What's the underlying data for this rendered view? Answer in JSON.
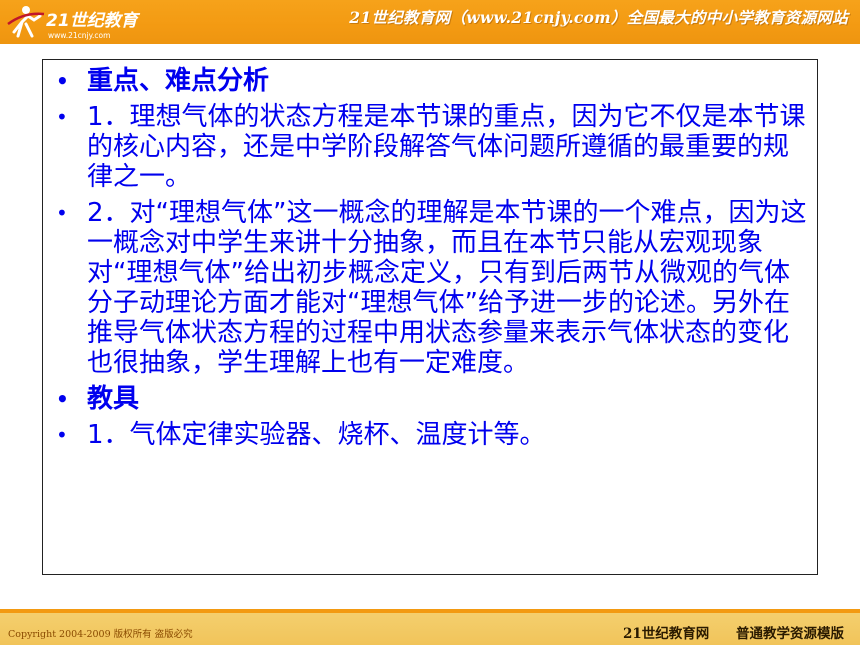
{
  "header": {
    "logo_text": "21世纪教育",
    "logo_url_text": "www.21cnjy.com",
    "site_title": "21世纪教育网（www.21cnjy.com）全国最大的中小学教育资源网站"
  },
  "content": {
    "items": [
      {
        "text": "重点、难点分析",
        "heading": true
      },
      {
        "text": "1．理想气体的状态方程是本节课的重点，因为它不仅是本节课的核心内容，还是中学阶段解答气体问题所遵循的最重要的规律之一。",
        "heading": false
      },
      {
        "text": "2．对“理想气体”这一概念的理解是本节课的一个难点，因为这一概念对中学生来讲十分抽象，而且在本节只能从宏观现象对“理想气体”给出初步概念定义，只有到后两节从微观的气体分子动理论方面才能对“理想气体”给予进一步的论述。另外在推导气体状态方程的过程中用状态参量来表示气体状态的变化也很抽象，学生理解上也有一定难度。",
        "heading": false
      },
      {
        "text": "教具",
        "heading": true
      },
      {
        "text": "1．气体定律实验器、烧杯、温度计等。",
        "heading": false
      }
    ]
  },
  "footer": {
    "copyright": "Copyright 2004-2009 版权所有 盗版必究",
    "site_name": "21世纪教育网",
    "template_name": "普通教学资源模版"
  },
  "colors": {
    "header_orange": "#f39a12",
    "footer_yellow": "#f1c45a",
    "body_text_blue": "#0000ee"
  }
}
